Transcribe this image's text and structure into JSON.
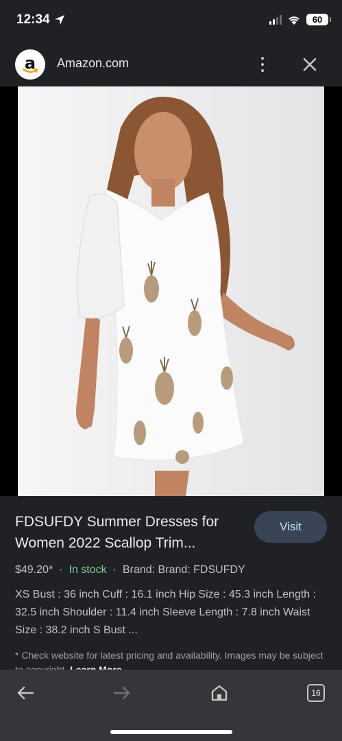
{
  "status_bar": {
    "time": "12:34",
    "battery": "60"
  },
  "header": {
    "site_name": "Amazon.com",
    "logo_letter": "a"
  },
  "product": {
    "title": "FDSUFDY Summer Dresses for Women 2022 Scallop Trim...",
    "visit_label": "Visit",
    "price": "$49.20*",
    "separator": "·",
    "stock": "In stock",
    "brand": "Brand: Brand: FDSUFDY",
    "description": "XS Bust : 36 inch Cuff : 16.1 inch Hip Size : 45.3 inch Length : 32.5 inch Shoulder : 11.4 inch Sleeve Length : 7.8 inch Waist Size : 38.2 inch S Bust ...",
    "disclaimer": "* Check website for latest pricing and availability. Images may be subject to copyright.",
    "learn_more": "Learn More"
  },
  "toolbar": {
    "tab_count": "16"
  },
  "colors": {
    "background": "#202124",
    "stock_green": "#81c995",
    "visit_bg": "#394457",
    "visit_text": "#c2e7ff",
    "toolbar_bg": "#35363a"
  },
  "icons": [
    "location-arrow-icon",
    "signal-icon",
    "wifi-icon",
    "battery-icon",
    "more-vert-icon",
    "close-icon",
    "back-arrow-icon",
    "forward-arrow-icon",
    "home-icon",
    "tab-switcher-icon"
  ]
}
